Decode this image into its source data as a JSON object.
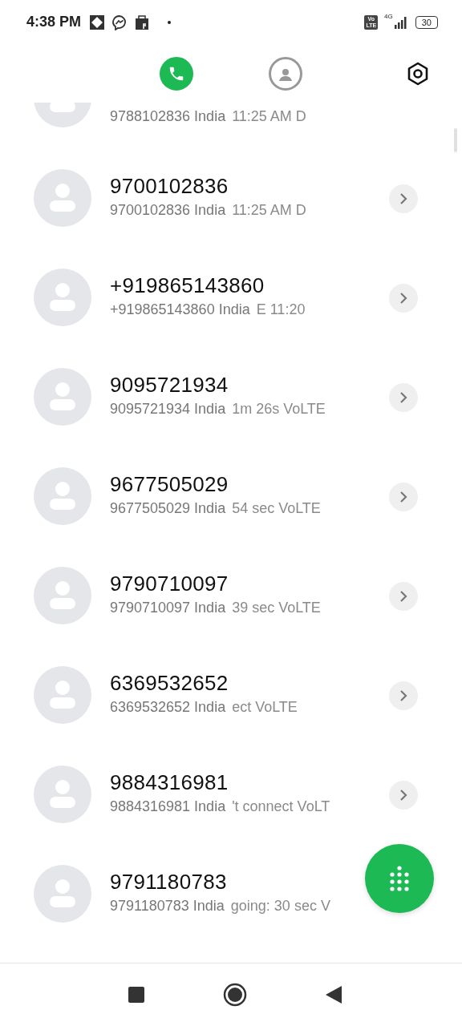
{
  "status_bar": {
    "time": "4:38 PM",
    "volte": [
      "Vo",
      "LTE"
    ],
    "network": "4G",
    "battery": "30"
  },
  "tabs": [
    {
      "kind": "calls",
      "selected": true
    },
    {
      "kind": "contacts",
      "selected": false
    }
  ],
  "calls": [
    {
      "kind": "partial",
      "detail": "9788102836 India",
      "extra": "11:25 AM D"
    },
    {
      "kind": "full",
      "title": "9700102836",
      "detail": "9700102836 India",
      "extra": "11:25 AM D"
    },
    {
      "kind": "full",
      "title": "+919865143860",
      "detail": "+919865143860 India",
      "extra": "E      11:20"
    },
    {
      "kind": "full",
      "title": "9095721934",
      "detail": "9095721934 India",
      "extra": "1m 26s VoLTE"
    },
    {
      "kind": "full",
      "title": "9677505029",
      "detail": "9677505029 India",
      "extra": "54 sec VoLTE"
    },
    {
      "kind": "full",
      "title": "9790710097",
      "detail": "9790710097 India",
      "extra": "39 sec VoLTE"
    },
    {
      "kind": "full",
      "title": "6369532652",
      "detail": "6369532652 India",
      "extra": "ect VoLTE"
    },
    {
      "kind": "full",
      "title": "9884316981",
      "detail": "9884316981 India",
      "extra": "'t connect VoLT"
    },
    {
      "kind": "last",
      "title": "9791180783",
      "detail": "9791180783 India",
      "extra": "going: 30 sec V"
    }
  ]
}
